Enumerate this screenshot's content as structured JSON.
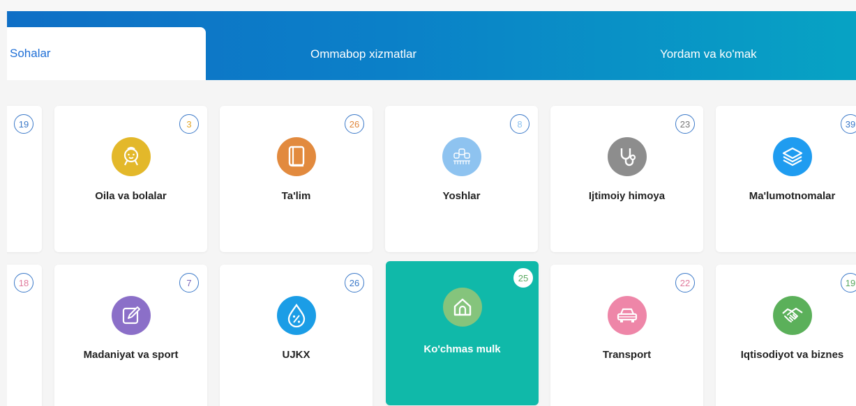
{
  "tabs": [
    {
      "label": "Sohalar",
      "active": true
    },
    {
      "label": "Ommabop xizmatlar",
      "active": false
    },
    {
      "label": "Yordam va ko'mak",
      "active": false
    }
  ],
  "row1": {
    "partial_badge": "19",
    "cards": [
      {
        "label": "Oila va bolalar",
        "count": "3",
        "icon": "baby-face-icon",
        "color": "#e3b82a",
        "badge_color": "#e3a72a"
      },
      {
        "label": "Ta'lim",
        "count": "26",
        "icon": "book-icon",
        "color": "#e28a3e",
        "badge_color": "#e0863a"
      },
      {
        "label": "Yoshlar",
        "count": "8",
        "icon": "youth-group-icon",
        "color": "#8ec3f0",
        "badge_color": "#8ec3f0"
      },
      {
        "label": "Ijtimoiy himoya",
        "count": "23",
        "icon": "stethoscope-icon",
        "color": "#8d8d8d",
        "badge_color": "#777777"
      },
      {
        "label": "Ma'lumotnomalar",
        "count": "39",
        "icon": "layers-icon",
        "color": "#1f9cf0",
        "badge_color": "#3a78c8"
      }
    ]
  },
  "row2": {
    "partial_badge": "18",
    "cards": [
      {
        "label": "Madaniyat va sport",
        "count": "7",
        "icon": "pen-edit-icon",
        "color": "#8b6fc8",
        "badge_color": "#7a64b8"
      },
      {
        "label": "UJKX",
        "count": "26",
        "icon": "water-drop-percent-icon",
        "color": "#1b9de6",
        "badge_color": "#3a78c8"
      },
      {
        "label": "Ko'chmas mulk",
        "count": "25",
        "icon": "house-icon",
        "color": "#85c47c",
        "badge_color": "#5aa860",
        "highlight": true
      },
      {
        "label": "Transport",
        "count": "22",
        "icon": "car-icon",
        "color": "#ee86a8",
        "badge_color": "#e07a9c"
      },
      {
        "label": "Iqtisodiyot va biznes",
        "count": "19",
        "icon": "handshake-icon",
        "color": "#5bb05a",
        "badge_color": "#5aa860"
      }
    ]
  },
  "colors": {
    "accent": "#1f6fd6",
    "highlight_card": "#10b9a9",
    "badge_border": "#3a78c8"
  }
}
